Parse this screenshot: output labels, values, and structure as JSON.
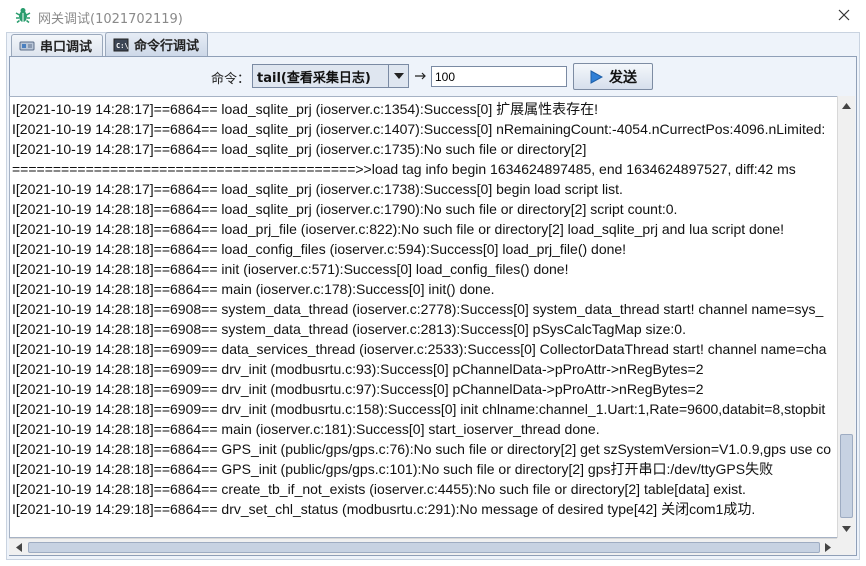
{
  "window": {
    "title": "网关调试(1021702119)"
  },
  "tabs": [
    {
      "label": "串口调试",
      "icon": "serial-port-icon"
    },
    {
      "label": "命令行调试",
      "icon": "terminal-icon"
    }
  ],
  "command_bar": {
    "label": "命令：",
    "selected_command": "tail(查看采集日志)",
    "count_value": "100",
    "send_label": "发送"
  },
  "colors": {
    "accent_icon": "#2a9d6e",
    "send_icon": "#2f7fd6",
    "panel_bg": "#eef3fa"
  },
  "log": [
    "I[2021-10-19 14:28:17]==6864== load_sqlite_prj (ioserver.c:1354):Success[0] 扩展属性表存在!",
    "I[2021-10-19 14:28:17]==6864== load_sqlite_prj (ioserver.c:1407):Success[0] nRemainingCount:-4054.nCurrectPos:4096.nLimited:",
    "I[2021-10-19 14:28:17]==6864== load_sqlite_prj (ioserver.c:1735):No such file or directory[2]",
    "==========================================>>load tag info begin 1634624897485, end 1634624897527, diff:42 ms",
    "I[2021-10-19 14:28:17]==6864== load_sqlite_prj (ioserver.c:1738):Success[0] begin load script list.",
    "I[2021-10-19 14:28:18]==6864== load_sqlite_prj (ioserver.c:1790):No such file or directory[2] script count:0.",
    "I[2021-10-19 14:28:18]==6864== load_prj_file (ioserver.c:822):No such file or directory[2] load_sqlite_prj and lua script done!",
    "I[2021-10-19 14:28:18]==6864== load_config_files (ioserver.c:594):Success[0] load_prj_file() done!",
    "I[2021-10-19 14:28:18]==6864== init (ioserver.c:571):Success[0] load_config_files() done!",
    "I[2021-10-19 14:28:18]==6864== main (ioserver.c:178):Success[0] init() done.",
    "I[2021-10-19 14:28:18]==6908== system_data_thread (ioserver.c:2778):Success[0] system_data_thread start! channel name=sys_",
    "I[2021-10-19 14:28:18]==6908== system_data_thread (ioserver.c:2813):Success[0] pSysCalcTagMap size:0.",
    "I[2021-10-19 14:28:18]==6909== data_services_thread (ioserver.c:2533):Success[0] CollectorDataThread start! channel name=cha",
    "I[2021-10-19 14:28:18]==6909== drv_init (modbusrtu.c:93):Success[0] pChannelData->pProAttr->nRegBytes=2",
    "I[2021-10-19 14:28:18]==6909== drv_init (modbusrtu.c:97):Success[0] pChannelData->pProAttr->nRegBytes=2",
    "I[2021-10-19 14:28:18]==6909== drv_init (modbusrtu.c:158):Success[0] init chlname:channel_1.Uart:1,Rate=9600,databit=8,stopbit",
    "I[2021-10-19 14:28:18]==6864== main (ioserver.c:181):Success[0] start_ioserver_thread done.",
    "I[2021-10-19 14:28:18]==6864== GPS_init (public/gps/gps.c:76):No such file or directory[2] get szSystemVersion=V1.0.9,gps use co",
    "I[2021-10-19 14:28:18]==6864== GPS_init (public/gps/gps.c:101):No such file or directory[2] gps打开串口:/dev/ttyGPS失败",
    "I[2021-10-19 14:28:18]==6864== create_tb_if_not_exists (ioserver.c:4455):No such file or directory[2] table[data] exist.",
    "I[2021-10-19 14:29:18]==6864== drv_set_chl_status (modbusrtu.c:291):No message of desired type[42] 关闭com1成功."
  ]
}
